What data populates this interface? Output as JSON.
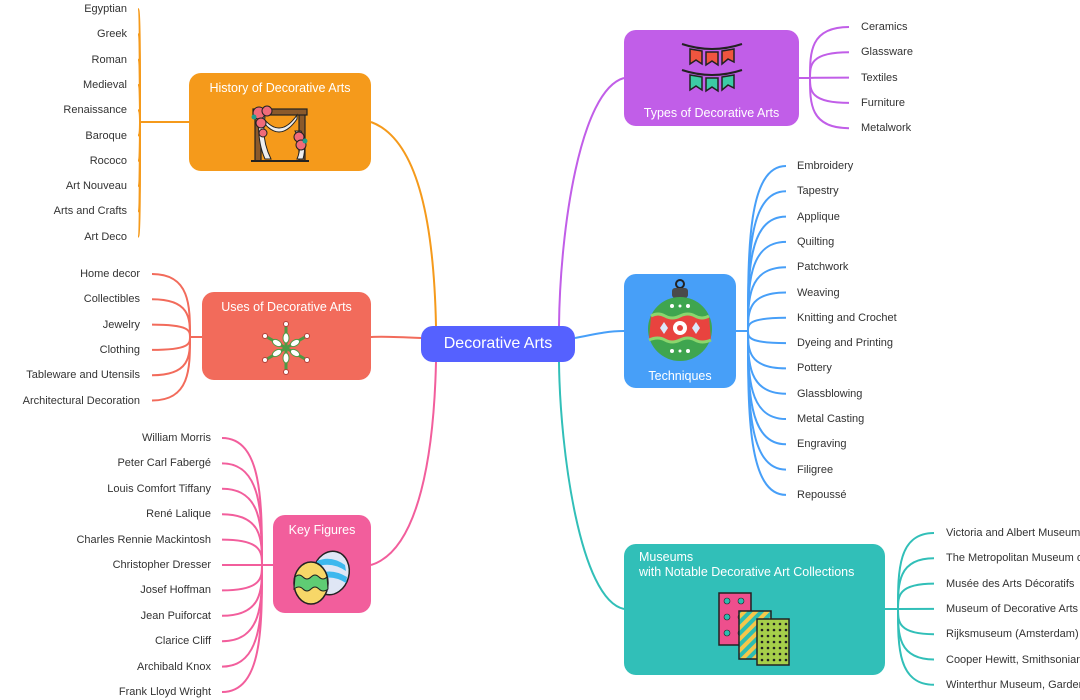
{
  "central": {
    "label": "Decorative Arts",
    "color": "#5561ff"
  },
  "branches": {
    "history": {
      "title": "History of Decorative Arts",
      "color": "#f59a1b",
      "icon": "arch-icon",
      "items": [
        "Egyptian",
        "Greek",
        "Roman",
        "Medieval",
        "Renaissance",
        "Baroque",
        "Rococo",
        "Art Nouveau",
        "Arts and Crafts",
        "Art Deco"
      ]
    },
    "uses": {
      "title": "Uses of Decorative Arts",
      "color": "#f26b5b",
      "icon": "snowflake-icon",
      "items": [
        "Home decor",
        "Collectibles",
        "Jewelry",
        "Clothing",
        "Tableware and Utensils",
        "Architectural Decoration"
      ]
    },
    "figures": {
      "title": "Key Figures",
      "color": "#f25e9c",
      "icon": "easter-eggs-icon",
      "items": [
        "William Morris",
        "Peter Carl Fabergé",
        "Louis Comfort Tiffany",
        "René Lalique",
        "Charles Rennie Mackintosh",
        "Christopher Dresser",
        "Josef Hoffman",
        "Jean Puiforcat",
        "Clarice Cliff",
        "Archibald Knox",
        "Frank Lloyd Wright"
      ]
    },
    "types": {
      "title": "Types of Decorative Arts",
      "color": "#c15ee8",
      "icon": "bunting-icon",
      "items": [
        "Ceramics",
        "Glassware",
        "Textiles",
        "Furniture",
        "Metalwork"
      ]
    },
    "techniques": {
      "title": "Techniques",
      "color": "#479ff8",
      "icon": "ornament-icon",
      "items": [
        "Embroidery",
        "Tapestry",
        "Applique",
        "Quilting",
        "Patchwork",
        "Weaving",
        "Knitting and Crochet",
        "Dyeing and Printing",
        "Pottery",
        "Glassblowing",
        "Metal Casting",
        "Engraving",
        "Filigree",
        "Repoussé"
      ]
    },
    "museums": {
      "title_line1": "Museums",
      "title_line2": "with Notable Decorative Art Collections",
      "color": "#31bfb8",
      "icon": "patterned-papers-icon",
      "items": [
        "Victoria and Albert Museum",
        "The Metropolitan Museum of Art",
        "Musée des Arts Décoratifs",
        "Museum of Decorative Arts",
        "Rijksmuseum (Amsterdam)",
        "Cooper Hewitt, Smithsonian Design Museum",
        "Winterthur Museum, Garden & Library"
      ]
    }
  }
}
